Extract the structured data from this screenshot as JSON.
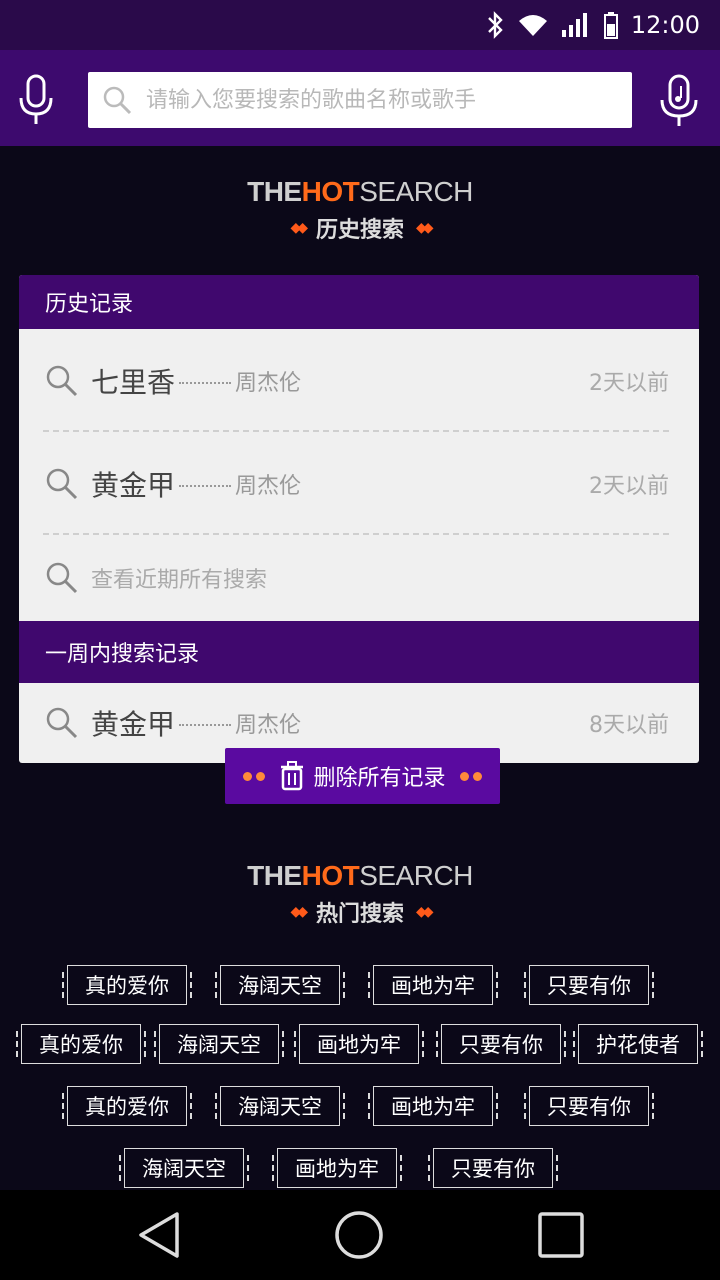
{
  "status": {
    "time": "12:00"
  },
  "search": {
    "placeholder": "请输入您要搜索的歌曲名称或歌手"
  },
  "history_section": {
    "logo_the": "THE",
    "logo_hot": "HOT",
    "logo_search": "SEARCH",
    "subtitle": "历史搜索"
  },
  "history_card": {
    "header": "历史记录",
    "rows": [
      {
        "song": "七里香",
        "singer": "周杰伦",
        "time": "2天以前"
      },
      {
        "song": "黄金甲",
        "singer": "周杰伦",
        "time": "2天以前"
      }
    ],
    "view_all": "查看近期所有搜索"
  },
  "week_card": {
    "header": "一周内搜索记录",
    "rows": [
      {
        "song": "黄金甲",
        "singer": "周杰伦",
        "time": "8天以前"
      }
    ]
  },
  "delete_all": {
    "label": "删除所有记录"
  },
  "hot_section": {
    "logo_the": "THE",
    "logo_hot": "HOT",
    "logo_search": "SEARCH",
    "subtitle": "热门搜索"
  },
  "hot_tags": [
    [
      "真的爱你",
      "海阔天空",
      "画地为牢",
      "只要有你"
    ],
    [
      "真的爱你",
      "海阔天空",
      "画地为牢",
      "只要有你",
      "护花使者"
    ],
    [
      "真的爱你",
      "海阔天空",
      "画地为牢",
      "只要有你"
    ],
    [
      "海阔天空",
      "画地为牢",
      "只要有你"
    ]
  ],
  "colors": {
    "accent": "#ff6a1a",
    "header_purple": "#3d0a6e",
    "card_purple": "#40086e",
    "background": "#0b0818"
  }
}
